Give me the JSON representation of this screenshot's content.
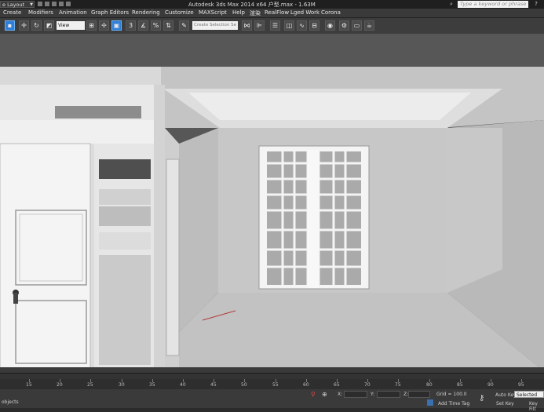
{
  "window": {
    "workspace_label": "e Layout",
    "title": "Autodesk 3ds Max  2014 x64      户型.max - 1.63M",
    "search_placeholder": "Type a keyword or phrase"
  },
  "menubar": {
    "items": [
      "Create",
      "Modifiers",
      "Animation",
      "Graph Editors",
      "Rendering",
      "Customize",
      "MAXScript",
      "Help",
      "渲染",
      "RealFlow",
      "Lged Work",
      "Corona"
    ]
  },
  "toolbar": {
    "view_value": "View",
    "selection_set_placeholder": "Create Selection Se"
  },
  "timeline": {
    "ticks": [
      "15",
      "20",
      "25",
      "30",
      "35",
      "40",
      "45",
      "50",
      "55",
      "60",
      "65",
      "70",
      "75",
      "80",
      "85",
      "90",
      "95"
    ]
  },
  "statusbar": {
    "objects_text": "objects",
    "x_label": "X:",
    "y_label": "Y:",
    "z_label": "Z:",
    "grid_text": "Grid = 100.0",
    "add_time_tag": "Add Time Tag",
    "auto_key": "Auto Key",
    "set_key": "Set Key",
    "selected_value": "Selected",
    "key_filters": "Key Filt"
  },
  "colors": {
    "accent": "#2f7fd6",
    "viewport_bg": "#575757",
    "scene_white": "#f2f2f2"
  }
}
